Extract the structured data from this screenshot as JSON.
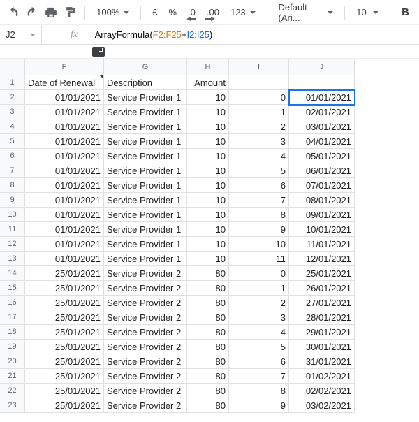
{
  "toolbar": {
    "zoom": "100%",
    "currency": "£",
    "percent": "%",
    "dec_dec": ".0",
    "dec_inc": ".00",
    "num_fmt": "123",
    "font": "Default (Ari...",
    "font_size": "10",
    "bold": "B"
  },
  "namebox": "J2",
  "fx_label": "fx",
  "formula": {
    "prefix": "=ArrayFormula",
    "open": "(",
    "range1": "F2:F25",
    "plus": "+",
    "range2": "I2:I25",
    "close": ")"
  },
  "columns": [
    "F",
    "G",
    "H",
    "I",
    "J"
  ],
  "header_row": {
    "F": "Date of Renewal",
    "G": "Description",
    "H": "Amount",
    "I": "",
    "J": ""
  },
  "selected_cell": "J2",
  "chart_data": {
    "type": "table",
    "columns": [
      "row",
      "Date of Renewal",
      "Description",
      "Amount",
      "I",
      "J"
    ],
    "rows": [
      [
        2,
        "01/01/2021",
        "Service Provider 1",
        10,
        0,
        "01/01/2021"
      ],
      [
        3,
        "01/01/2021",
        "Service Provider 1",
        10,
        1,
        "02/01/2021"
      ],
      [
        4,
        "01/01/2021",
        "Service Provider 1",
        10,
        2,
        "03/01/2021"
      ],
      [
        5,
        "01/01/2021",
        "Service Provider 1",
        10,
        3,
        "04/01/2021"
      ],
      [
        6,
        "01/01/2021",
        "Service Provider 1",
        10,
        4,
        "05/01/2021"
      ],
      [
        7,
        "01/01/2021",
        "Service Provider 1",
        10,
        5,
        "06/01/2021"
      ],
      [
        8,
        "01/01/2021",
        "Service Provider 1",
        10,
        6,
        "07/01/2021"
      ],
      [
        9,
        "01/01/2021",
        "Service Provider 1",
        10,
        7,
        "08/01/2021"
      ],
      [
        10,
        "01/01/2021",
        "Service Provider 1",
        10,
        8,
        "09/01/2021"
      ],
      [
        11,
        "01/01/2021",
        "Service Provider 1",
        10,
        9,
        "10/01/2021"
      ],
      [
        12,
        "01/01/2021",
        "Service Provider 1",
        10,
        10,
        "11/01/2021"
      ],
      [
        13,
        "01/01/2021",
        "Service Provider 1",
        10,
        11,
        "12/01/2021"
      ],
      [
        14,
        "25/01/2021",
        "Service Provider 2",
        80,
        0,
        "25/01/2021"
      ],
      [
        15,
        "25/01/2021",
        "Service Provider 2",
        80,
        1,
        "26/01/2021"
      ],
      [
        16,
        "25/01/2021",
        "Service Provider 2",
        80,
        2,
        "27/01/2021"
      ],
      [
        17,
        "25/01/2021",
        "Service Provider 2",
        80,
        3,
        "28/01/2021"
      ],
      [
        18,
        "25/01/2021",
        "Service Provider 2",
        80,
        4,
        "29/01/2021"
      ],
      [
        19,
        "25/01/2021",
        "Service Provider 2",
        80,
        5,
        "30/01/2021"
      ],
      [
        20,
        "25/01/2021",
        "Service Provider 2",
        80,
        6,
        "31/01/2021"
      ],
      [
        21,
        "25/01/2021",
        "Service Provider 2",
        80,
        7,
        "01/02/2021"
      ],
      [
        22,
        "25/01/2021",
        "Service Provider 2",
        80,
        8,
        "02/02/2021"
      ],
      [
        23,
        "25/01/2021",
        "Service Provider 2",
        80,
        9,
        "03/02/2021"
      ]
    ]
  }
}
